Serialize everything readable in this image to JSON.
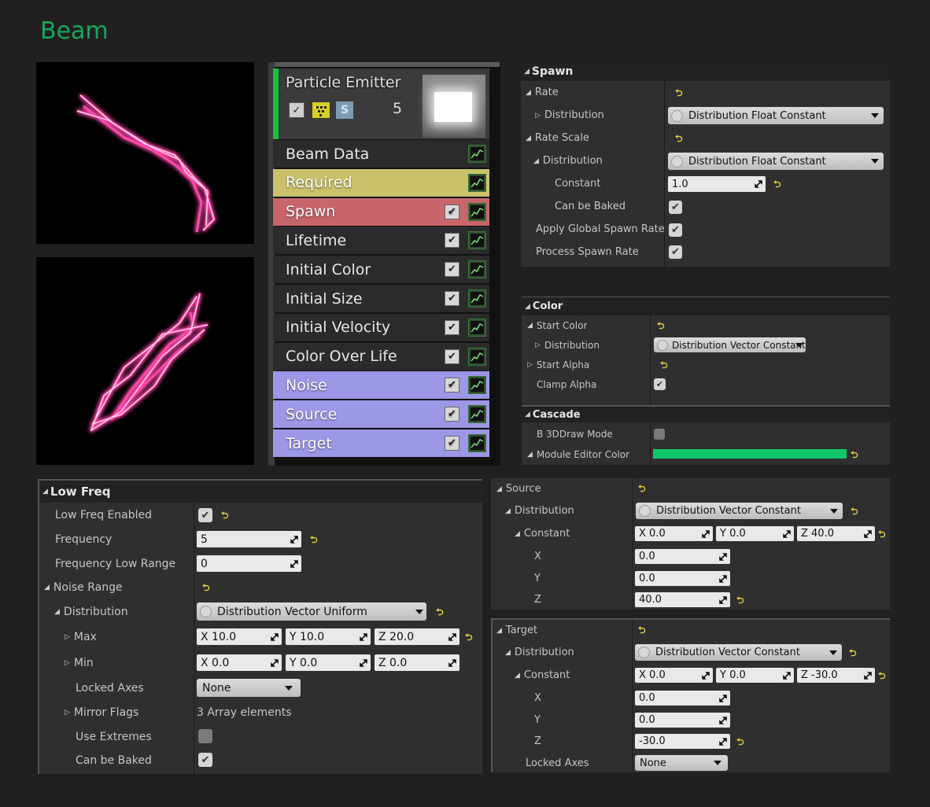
{
  "title": "Beam",
  "emitter": {
    "name": "Particle Emitter",
    "count": "5",
    "s_label": "S",
    "modules": [
      {
        "label": "Beam Data",
        "bg": "#2b2b2b",
        "fg": "#e8e8e8",
        "checkbox": false
      },
      {
        "label": "Required",
        "bg": "#c9c26b",
        "fg": "#ffffff",
        "checkbox": false
      },
      {
        "label": "Spawn",
        "bg": "#c8656a",
        "fg": "#ffffff",
        "checkbox": true
      },
      {
        "label": "Lifetime",
        "bg": "#2b2b2b",
        "fg": "#e8e8e8",
        "checkbox": true
      },
      {
        "label": "Initial Color",
        "bg": "#2b2b2b",
        "fg": "#e8e8e8",
        "checkbox": true
      },
      {
        "label": "Initial Size",
        "bg": "#2b2b2b",
        "fg": "#e8e8e8",
        "checkbox": true
      },
      {
        "label": "Initial Velocity",
        "bg": "#2b2b2b",
        "fg": "#e8e8e8",
        "checkbox": true
      },
      {
        "label": "Color Over Life",
        "bg": "#2b2b2b",
        "fg": "#e8e8e8",
        "checkbox": true
      },
      {
        "label": "Noise",
        "bg": "#9c97e6",
        "fg": "#ffffff",
        "checkbox": true
      },
      {
        "label": "Source",
        "bg": "#9c97e6",
        "fg": "#ffffff",
        "checkbox": true
      },
      {
        "label": "Target",
        "bg": "#9c97e6",
        "fg": "#ffffff",
        "checkbox": true
      }
    ]
  },
  "spawn": {
    "section": "Spawn",
    "rate": "Rate",
    "distribution": "Distribution",
    "dist_value": "Distribution Float Constant",
    "rate_scale": "Rate Scale",
    "distribution2": "Distribution",
    "dist_value2": "Distribution Float Constant",
    "constant": "Constant",
    "constant_value": "1.0",
    "can_be_baked": "Can be Baked",
    "apply_global": "Apply Global Spawn Rate Scale",
    "process_spawn": "Process Spawn Rate"
  },
  "color": {
    "section": "Color",
    "start_color": "Start Color",
    "distribution": "Distribution",
    "dist_value": "Distribution Vector Constant",
    "start_alpha": "Start Alpha",
    "clamp_alpha": "Clamp Alpha",
    "cascade": "Cascade",
    "draw_mode": "B 3DDraw Mode",
    "module_color": "Module Editor Color",
    "module_color_hex": "#10c86a"
  },
  "lowfreq": {
    "section": "Low Freq",
    "enabled": "Low Freq Enabled",
    "frequency": "Frequency",
    "frequency_value": "5",
    "low_range": "Frequency Low Range",
    "low_range_value": "0",
    "noise_range": "Noise Range",
    "distribution": "Distribution",
    "dist_value": "Distribution Vector Uniform",
    "max": "Max",
    "max_x": "X  10.0",
    "max_y": "Y  10.0",
    "max_z": "Z  20.0",
    "min": "Min",
    "min_x": "X  0.0",
    "min_y": "Y  0.0",
    "min_z": "Z  0.0",
    "locked_axes": "Locked Axes",
    "locked_value": "None",
    "mirror_flags": "Mirror Flags",
    "mirror_value": "3 Array elements",
    "use_extremes": "Use Extremes",
    "can_be_baked": "Can be Baked"
  },
  "source": {
    "section": "Source",
    "distribution": "Distribution",
    "dist_value": "Distribution Vector Constant",
    "constant": "Constant",
    "cx": "X  0.0",
    "cy": "Y  0.0",
    "cz": "Z  40.0",
    "x": "X",
    "x_value": "0.0",
    "y": "Y",
    "y_value": "0.0",
    "z": "Z",
    "z_value": "40.0"
  },
  "target": {
    "section": "Target",
    "distribution": "Distribution",
    "dist_value": "Distribution Vector Constant",
    "constant": "Constant",
    "cx": "X  0.0",
    "cy": "Y  0.0",
    "cz": "Z  -30.0",
    "x": "X",
    "x_value": "0.0",
    "y": "Y",
    "y_value": "0.0",
    "z": "Z",
    "z_value": "-30.0",
    "locked_axes": "Locked Axes",
    "locked_value": "None"
  },
  "icons": {
    "reset": "⮌",
    "check": "✔"
  }
}
